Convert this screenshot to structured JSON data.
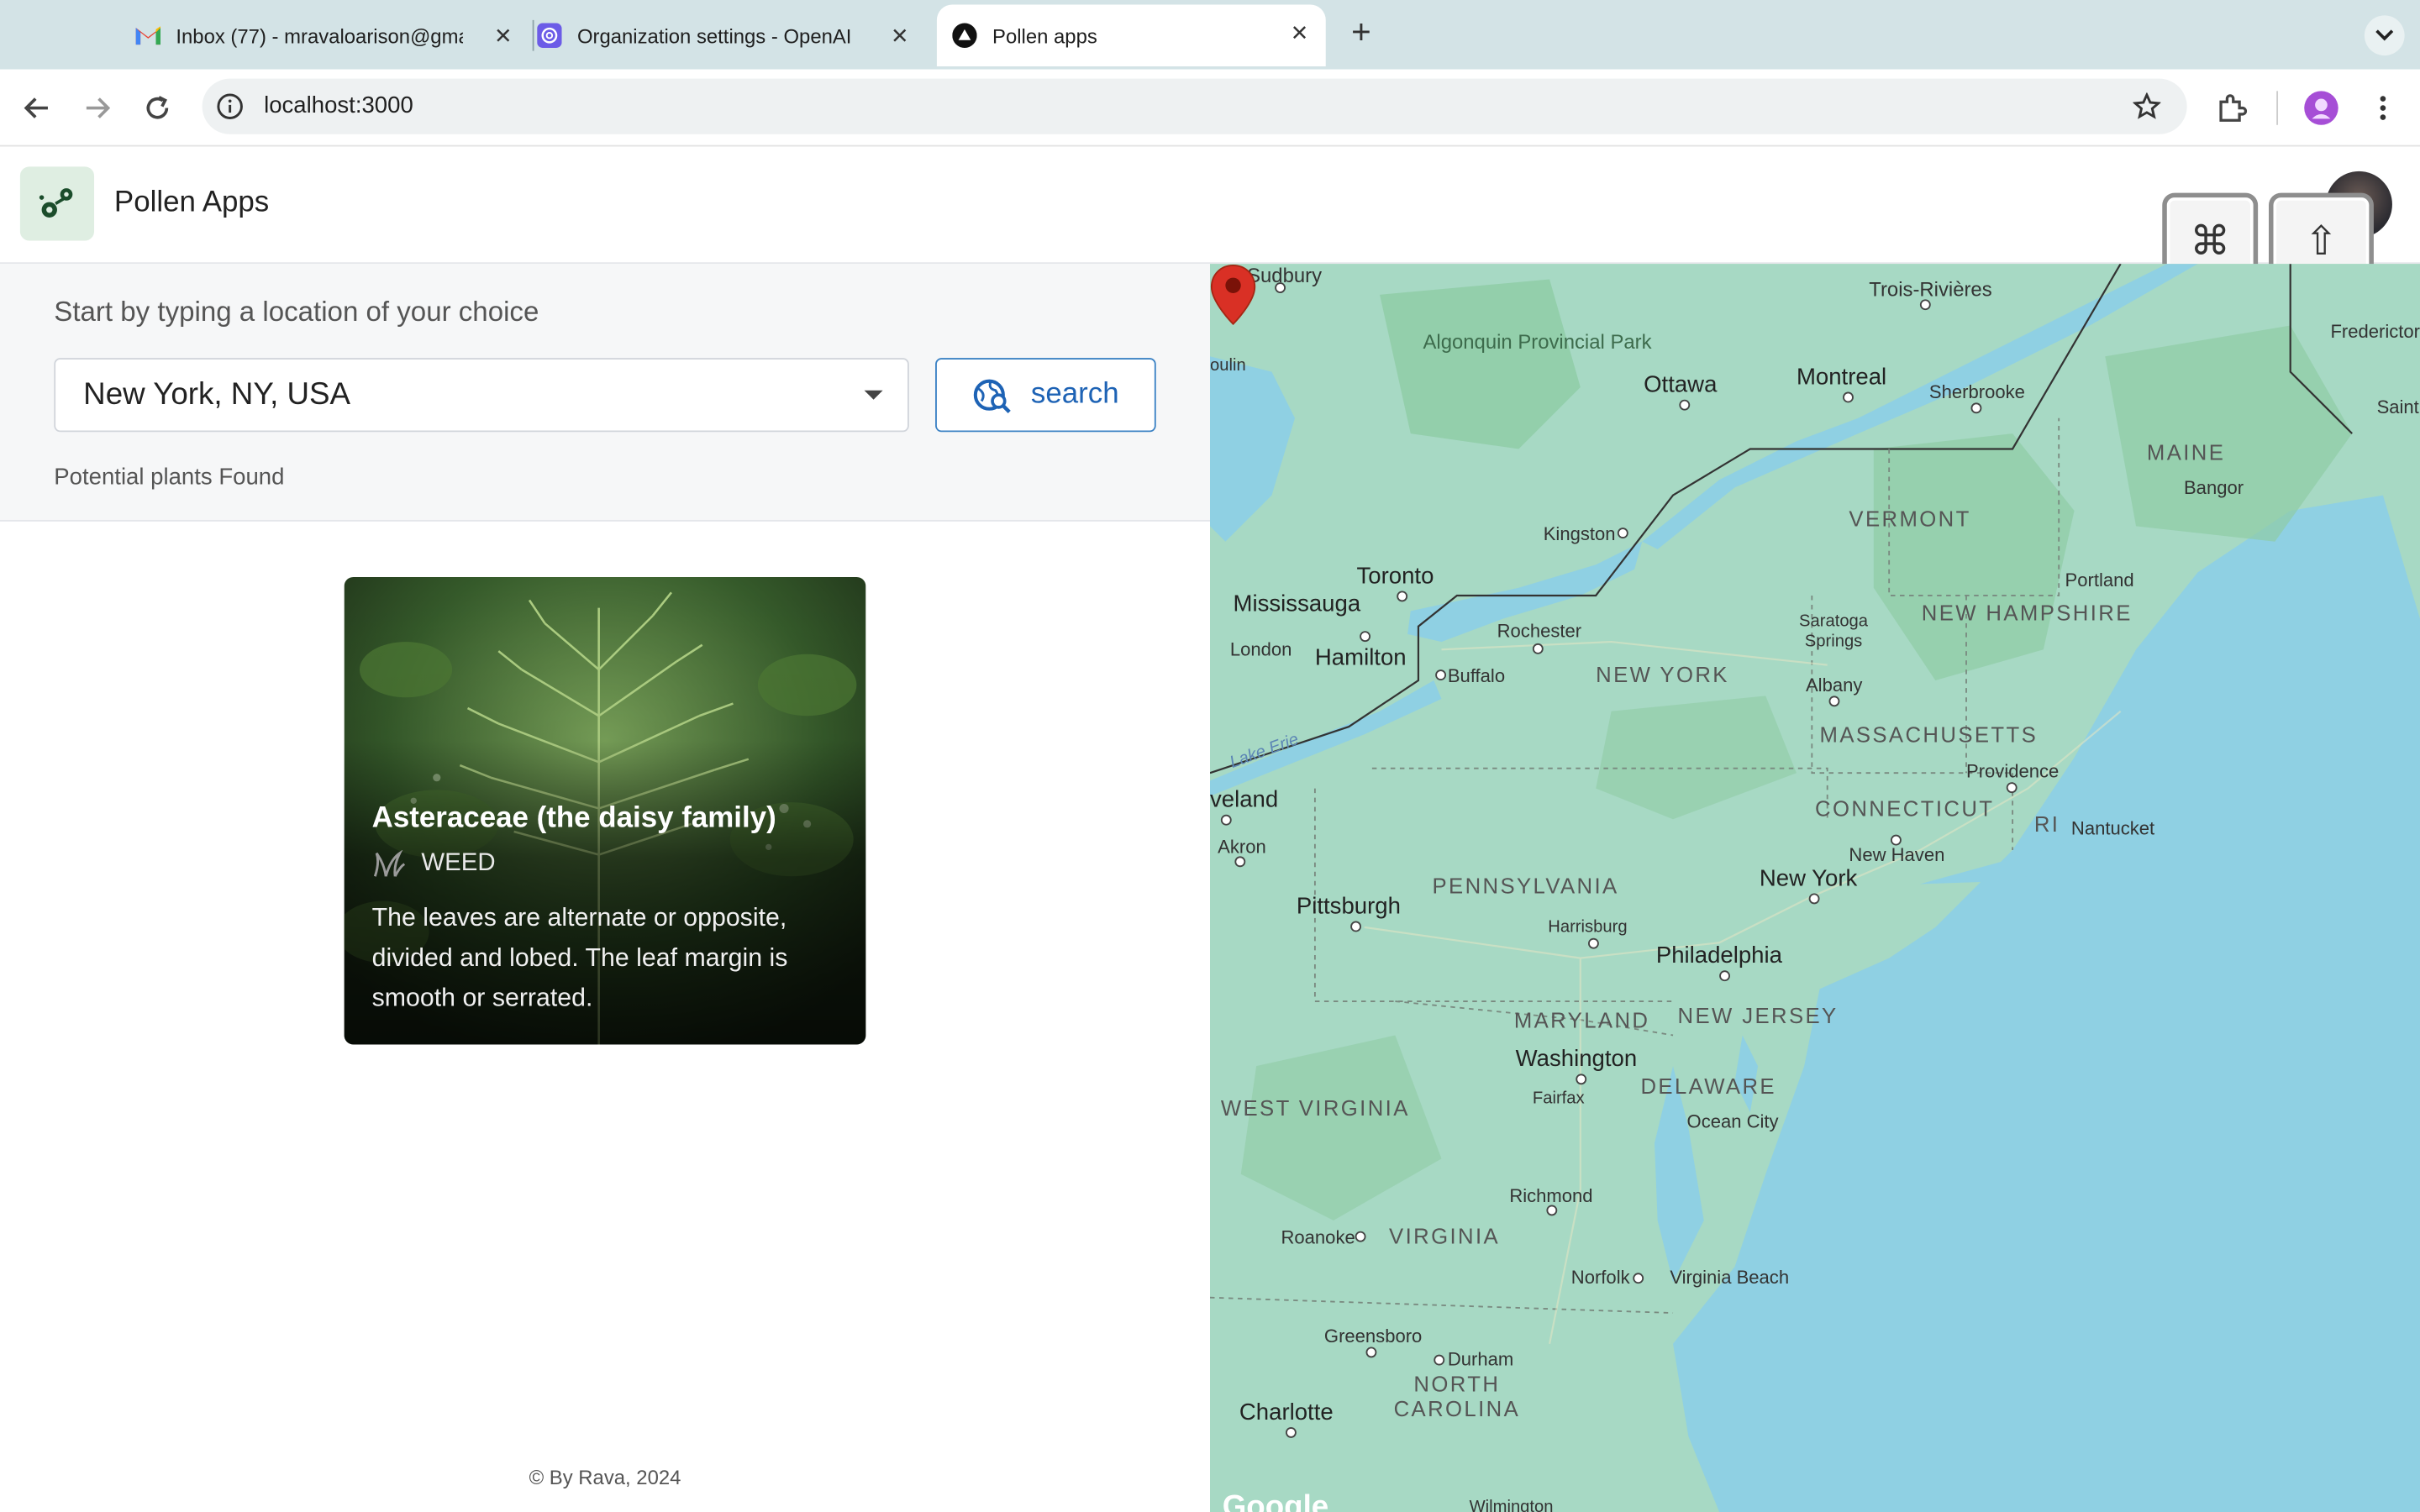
{
  "browser": {
    "tabs": [
      {
        "title": "Inbox (77) - mravaloarison@gmail.com",
        "icon": "gmail-icon"
      },
      {
        "title": "Organization settings - OpenAI API",
        "icon": "openai-icon"
      },
      {
        "title": "Pollen apps",
        "icon": "app-triangle-icon"
      }
    ],
    "url": "localhost:3000"
  },
  "app": {
    "name": "Pollen Apps",
    "keys": {
      "command": "⌘",
      "shift": "⇧"
    }
  },
  "search": {
    "prompt": "Start by typing a location of your choice",
    "location_value": "New York, NY, USA",
    "button_label": "search",
    "results_label": "Potential plants Found"
  },
  "plants": [
    {
      "name": "Asteraceae (the daisy family)",
      "type": "WEED",
      "description": "The leaves are alternate or opposite, divided and lobed. The leaf margin is smooth or serrated."
    }
  ],
  "footer": "© By Rava, 2024",
  "map": {
    "labels": {
      "sudbury": "Sudbury",
      "trois_rivieres": "Trois-Rivières",
      "fredericton": "Frederictor",
      "algonquin": "Algonquin Provincial Park",
      "ottawa": "Ottawa",
      "montreal": "Montreal",
      "sherbrooke": "Sherbrooke",
      "saint": "Saint",
      "maine": "MAINE",
      "bangor": "Bangor",
      "kingston": "Kingston",
      "vermont": "VERMONT",
      "toronto": "Toronto",
      "mississauga": "Mississauga",
      "portland": "Portland",
      "new_hampshire": "NEW HAMPSHIRE",
      "rochester": "Rochester",
      "saratoga": "Saratoga Springs",
      "london": "London",
      "hamilton": "Hamilton",
      "buffalo": "Buffalo",
      "new_york_state": "NEW YORK",
      "albany": "Albany",
      "massachusetts": "MASSACHUSETTS",
      "lake_erie": "Lake Erie",
      "providence": "Providence",
      "cleveland": "veland",
      "connecticut": "CONNECTICUT",
      "ri": "RI",
      "nantucket": "Nantucket",
      "akron": "Akron",
      "new_haven": "New Haven",
      "new_york_city": "New York",
      "pittsburgh": "Pittsburgh",
      "pennsylvania": "PENNSYLVANIA",
      "harrisburg": "Harrisburg",
      "philadelphia": "Philadelphia",
      "maryland": "MARYLAND",
      "new_jersey": "NEW JERSEY",
      "washington": "Washington",
      "delaware": "DELAWARE",
      "fairfax": "Fairfax",
      "west_virginia": "WEST VIRGINIA",
      "ocean_city": "Ocean City",
      "richmond": "Richmond",
      "roanoke": "Roanoke",
      "virginia": "VIRGINIA",
      "norfolk": "Norfolk",
      "virginia_beach": "Virginia Beach",
      "greensboro": "Greensboro",
      "durham": "Durham",
      "north_carolina": "NORTH CAROLINA",
      "charlotte": "Charlotte",
      "wilmington": "Wilmington",
      "poulin": "oulin"
    },
    "colors": {
      "land": "#a7d9c4",
      "water": "#8fd0e3",
      "forest": "#8fcca5",
      "pin": "#d93025"
    }
  }
}
